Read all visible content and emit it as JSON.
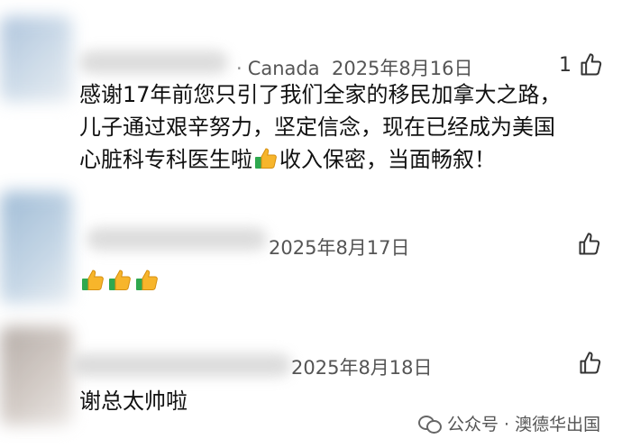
{
  "comments": [
    {
      "location": "Canada",
      "date": "2025年8月16日",
      "like_count": "1",
      "text_lines": [
        "感谢17年前您只引了我们全家的移民加拿大之路，",
        "儿子通过艰辛努力，坚定信念，现在已经成为美国"
      ],
      "line3_before": "心脏科专科医生啦",
      "line3_after": "收入保密，当面畅叙！"
    },
    {
      "date": "2025年8月17日",
      "emoji": "thumbs-up-icon"
    },
    {
      "date": "2025年8月18日",
      "text": "谢总太帅啦"
    }
  ],
  "meta_separator": "·",
  "watermark": {
    "text": "公众号 · 澳德华出国",
    "icon": "wechat-icon"
  },
  "colors": {
    "text": "#111111",
    "meta": "#555555",
    "emoji_yellow": "#f7b52b",
    "emoji_cuff": "#2fa84f"
  }
}
